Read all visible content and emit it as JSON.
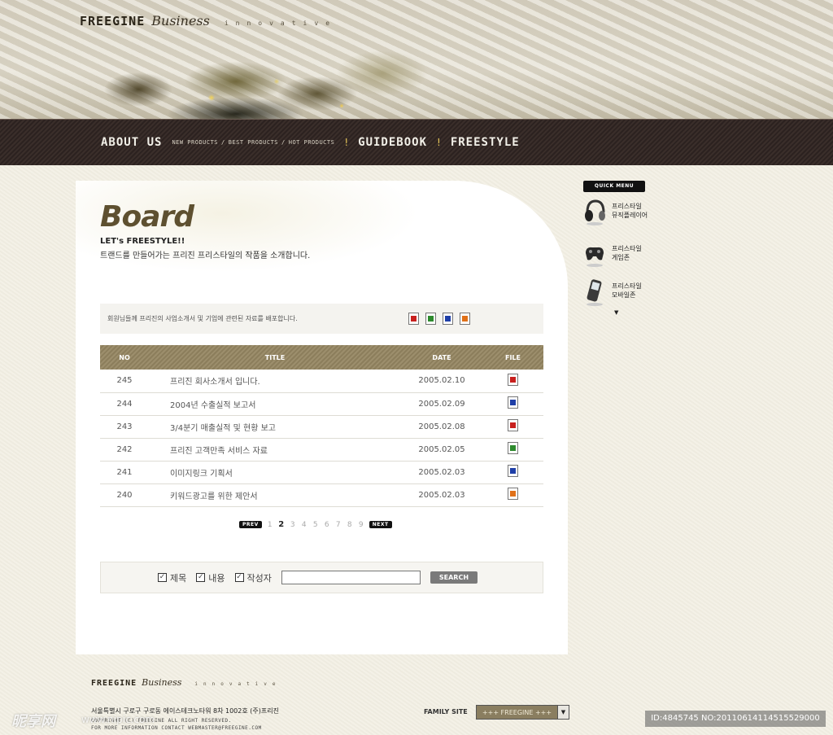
{
  "header": {
    "logo_main": "FREEGINE",
    "logo_script": "Business",
    "logo_tag": "innovative"
  },
  "nav": {
    "about": "ABOUT US",
    "sub_new": "NEW PRODUCTS",
    "sub_best": "BEST PRODUCTS",
    "sub_hot": "HOT PRODUCTS",
    "sub_sep": "/",
    "sep": "!",
    "guidebook": "GUIDEBOOK",
    "freestyle": "FREESTYLE"
  },
  "board": {
    "title": "Board",
    "subtitle1": "LET's FREESTYLE!!",
    "subtitle2": "트랜드를 만들어가는 프리진 프리스타일의 작품을 소개합니다.",
    "info_text": "회원님들께 프리진의 사업소개서 및 기업에 관련된 자료를 배포합니다.",
    "info_icons": [
      "pdf-icon",
      "xls-icon",
      "doc-icon",
      "ppt-icon"
    ]
  },
  "table": {
    "headers": {
      "no": "NO",
      "title": "TITLE",
      "date": "DATE",
      "file": "FILE"
    },
    "rows": [
      {
        "no": "245",
        "title": "프리진 회사소개서 입니다.",
        "date": "2005.02.10",
        "file": "pdf"
      },
      {
        "no": "244",
        "title": "2004년 수출실적 보고서",
        "date": "2005.02.09",
        "file": "doc"
      },
      {
        "no": "243",
        "title": "3/4분기 매출실적 및 현황 보고",
        "date": "2005.02.08",
        "file": "pdf"
      },
      {
        "no": "242",
        "title": "프리진 고객만족 서비스 자료",
        "date": "2005.02.05",
        "file": "xls"
      },
      {
        "no": "241",
        "title": "이미지링크 기획서",
        "date": "2005.02.03",
        "file": "doc"
      },
      {
        "no": "240",
        "title": "키워드광고를 위한 제안서",
        "date": "2005.02.03",
        "file": "ppt"
      }
    ]
  },
  "pagination": {
    "prev": "PREV",
    "next": "NEXT",
    "pages": [
      "1",
      "2",
      "3",
      "4",
      "5",
      "6",
      "7",
      "8",
      "9"
    ],
    "current": "2"
  },
  "search": {
    "options": [
      {
        "label": "제목",
        "checked": true
      },
      {
        "label": "내용",
        "checked": true
      },
      {
        "label": "작성자",
        "checked": true
      }
    ],
    "value": "",
    "button": "SEARCH"
  },
  "quick_menu": {
    "title": "QUICK MENU",
    "items": [
      {
        "line1": "프리스타일",
        "line2": "뮤직플레이어",
        "icon": "headphones-icon"
      },
      {
        "line1": "프리스타일",
        "line2": "게임존",
        "icon": "gamepad-icon"
      },
      {
        "line1": "프리스타일",
        "line2": "모바일존",
        "icon": "mobile-phone-icon"
      }
    ],
    "arrow": "▼"
  },
  "footer": {
    "logo_main": "FREEGINE",
    "logo_script": "Business",
    "logo_tag": "innovative",
    "address": "서울특별시 구로구 구로동 에이스테크노타워 8차 1002호 (주)프리진",
    "copyright1": "COPYRIGHT (C) FREEGINE ALL RIGHT RESERVED.",
    "copyright2": "FOR MORE INFORMATION CONTACT WEBMASTER@FREEGINE.COM",
    "family_label": "FAMILY SITE",
    "family_value": "+++ FREEGINE +++"
  },
  "watermark": {
    "left": "昵享网",
    "url": "www.nipic.com",
    "id": "ID:4845745 NO:20110614114515529000"
  }
}
